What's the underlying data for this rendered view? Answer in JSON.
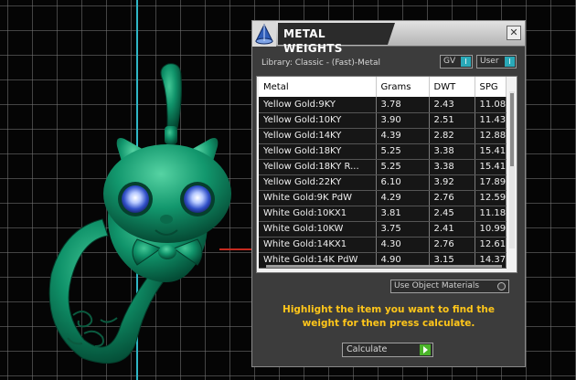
{
  "dialog": {
    "title": "METAL WEIGHTS",
    "close_glyph": "✕",
    "library_label": "Library: Classic - (Fast)-Metal",
    "gv_toggle": {
      "label": "GV",
      "knob": "I"
    },
    "user_toggle": {
      "label": "User",
      "knob": "I"
    },
    "columns": [
      "Metal",
      "Grams",
      "DWT",
      "SPG"
    ],
    "rows": [
      [
        "Yellow Gold:9KY",
        "3.78",
        "2.43",
        "11.08"
      ],
      [
        "Yellow Gold:10KY",
        "3.90",
        "2.51",
        "11.43"
      ],
      [
        "Yellow Gold:14KY",
        "4.39",
        "2.82",
        "12.88"
      ],
      [
        "Yellow Gold:18KY",
        "5.25",
        "3.38",
        "15.41"
      ],
      [
        "Yellow Gold:18KY R...",
        "5.25",
        "3.38",
        "15.41"
      ],
      [
        "Yellow Gold:22KY",
        "6.10",
        "3.92",
        "17.89"
      ],
      [
        "White Gold:9K PdW",
        "4.29",
        "2.76",
        "12.59"
      ],
      [
        "White Gold:10KX1",
        "3.81",
        "2.45",
        "11.18"
      ],
      [
        "White Gold:10KW",
        "3.75",
        "2.41",
        "10.99"
      ],
      [
        "White Gold:14KX1",
        "4.30",
        "2.76",
        "12.61"
      ],
      [
        "White Gold:14K PdW",
        "4.90",
        "3.15",
        "14.37"
      ]
    ],
    "use_object_materials_label": "Use Object Materials",
    "instruction": "Highlight the item you want to find the weight for then press calculate.",
    "calculate_label": "Calculate"
  },
  "colors": {
    "viewport_bg": "#050505",
    "grid": "#787878",
    "axis_vertical": "#2fb7c7",
    "axis_horizontal": "#c62a1f",
    "model_green": "#0f8a62",
    "instruction_text": "#ffc61a",
    "toggle_knob": "#2aa9b8",
    "calculate_play": "#4bb42a"
  },
  "icons": {
    "app": "triangle-flask-icon",
    "close": "close-icon",
    "calculate": "play-icon"
  }
}
